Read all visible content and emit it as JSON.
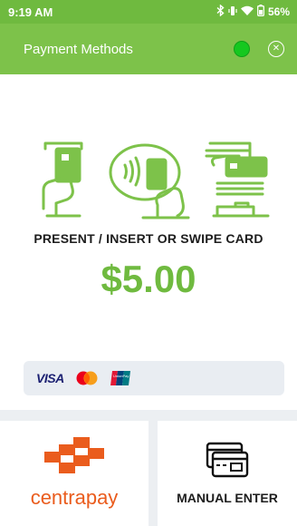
{
  "status_bar": {
    "time": "9:19 AM",
    "battery": "56%"
  },
  "header": {
    "title": "Payment Methods"
  },
  "prompt": "PRESENT / INSERT OR SWIPE CARD",
  "amount": "$5.00",
  "card_brands": {
    "visa": "VISA",
    "unionpay": "UnionPay"
  },
  "options": {
    "centrapay_label": "centrapay",
    "manual_label": "MANUAL ENTER"
  },
  "colors": {
    "brand_green": "#7dc24a",
    "status_green": "#15c81f",
    "centrapay_orange": "#ea5c1d"
  },
  "icons": [
    "bluetooth-icon",
    "wifi-icon",
    "battery-icon",
    "connection-dot",
    "close-icon",
    "insert-card-icon",
    "tap-card-icon",
    "swipe-card-icon",
    "mastercard-icon",
    "unionpay-icon",
    "centrapay-logo",
    "manual-card-icon"
  ]
}
